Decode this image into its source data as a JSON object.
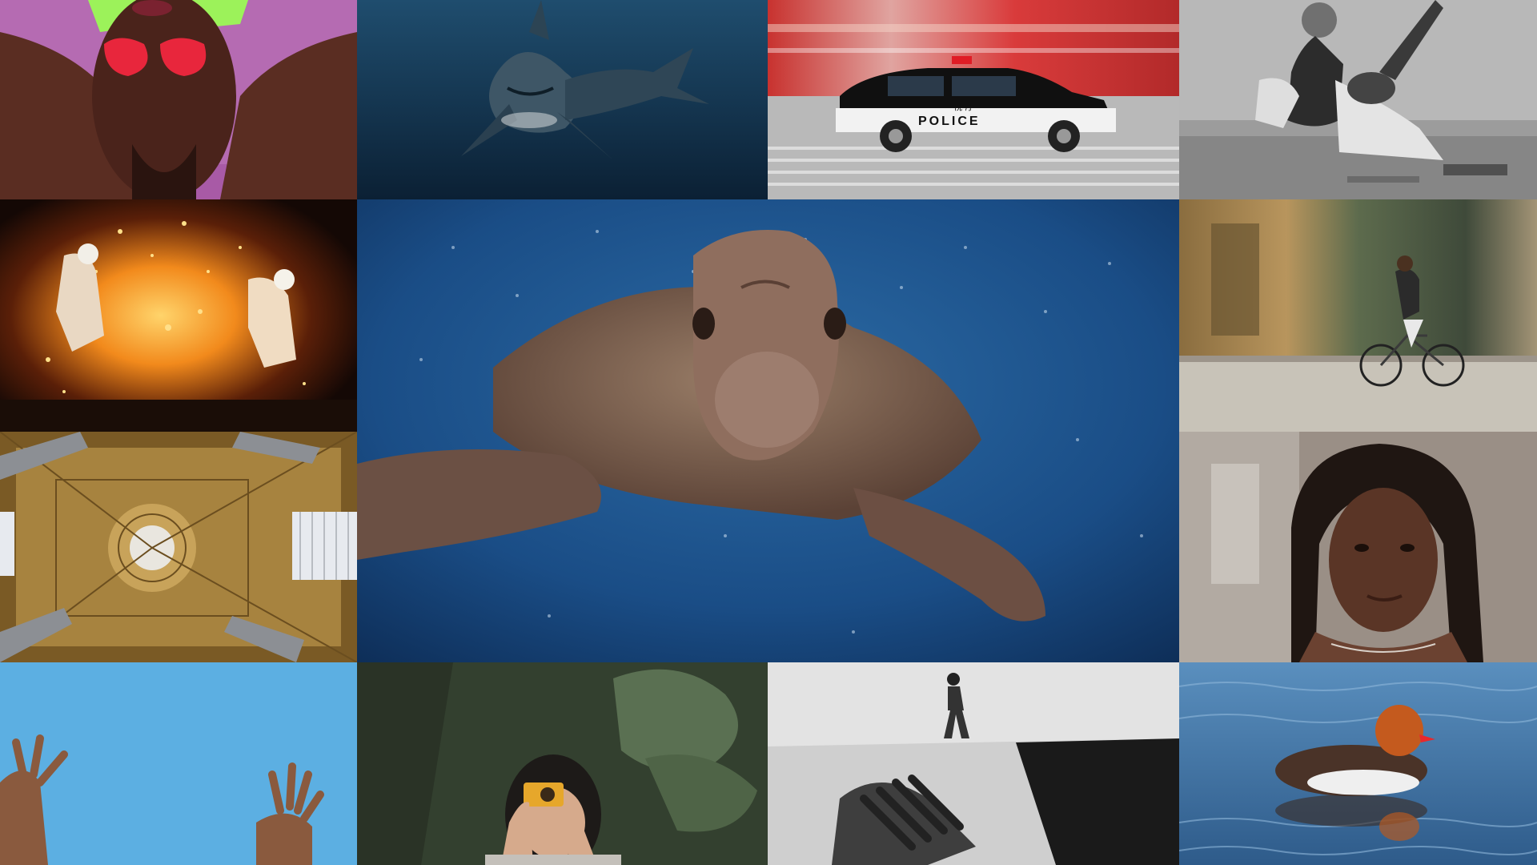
{
  "mosaic": {
    "police_car": {
      "door_text": "POLICE",
      "kanji": "視 庁"
    }
  },
  "colors": {
    "pink_bg": "#b468b0",
    "ocean_dark": "#13324d",
    "ocean_mid": "#1d4f86",
    "sparks": "#f39a20",
    "gold": "#a88238",
    "sky_blue": "#5caee0",
    "forest": "#3b4a38",
    "water_blue": "#4f86b8"
  }
}
